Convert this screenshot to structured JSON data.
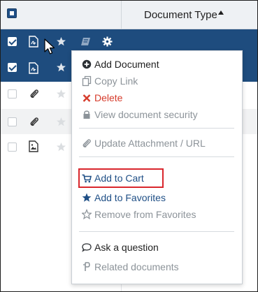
{
  "header": {
    "column_title": "Document Type"
  },
  "menu": {
    "items": [
      {
        "label": "Add Document",
        "icon": "plus-circle-icon"
      },
      {
        "label": "Copy Link",
        "icon": "copy-icon"
      },
      {
        "label": "Delete",
        "icon": "x-icon"
      },
      {
        "label": "View document security",
        "icon": "lock-icon"
      },
      {
        "label": "Update Attachment / URL",
        "icon": "paperclip-icon"
      },
      {
        "label": "Add to Cart",
        "icon": "cart-icon"
      },
      {
        "label": "Add to Favorites",
        "icon": "star-filled-icon"
      },
      {
        "label": "Remove from Favorites",
        "icon": "star-outline-icon"
      },
      {
        "label": "Ask a question",
        "icon": "speech-bubble-icon"
      },
      {
        "label": "Related documents",
        "icon": "related-icon"
      }
    ]
  },
  "colors": {
    "selection_blue": "#1e4c7e",
    "danger_red": "#d63b2b",
    "highlight_box": "#d9262c"
  }
}
